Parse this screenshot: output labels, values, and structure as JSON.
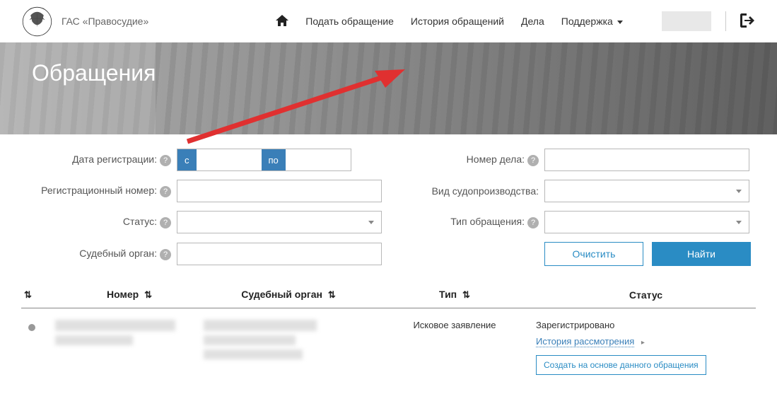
{
  "header": {
    "title": "ГАС «Правосудие»",
    "nav": {
      "home": "",
      "submit": "Подать обращение",
      "history": "История обращений",
      "cases": "Дела",
      "support": "Поддержка"
    }
  },
  "banner": {
    "title": "Обращения"
  },
  "filters": {
    "reg_date_label": "Дата регистрации:",
    "reg_num_label": "Регистрационный номер:",
    "status_label": "Статус:",
    "court_label": "Судебный орган:",
    "case_num_label": "Номер дела:",
    "proc_type_label": "Вид судопроизводства:",
    "appeal_type_label": "Тип обращения:",
    "date_from": "с",
    "date_to": "по",
    "clear_btn": "Очистить",
    "find_btn": "Найти"
  },
  "table": {
    "headers": {
      "num": "Номер",
      "court": "Судебный орган",
      "type": "Тип",
      "status": "Статус"
    },
    "rows": [
      {
        "type": "Исковое заявление",
        "status": "Зарегистрировано",
        "history_link": "История рассмотрения",
        "create_btn": "Создать на основе данного обращения"
      }
    ]
  }
}
